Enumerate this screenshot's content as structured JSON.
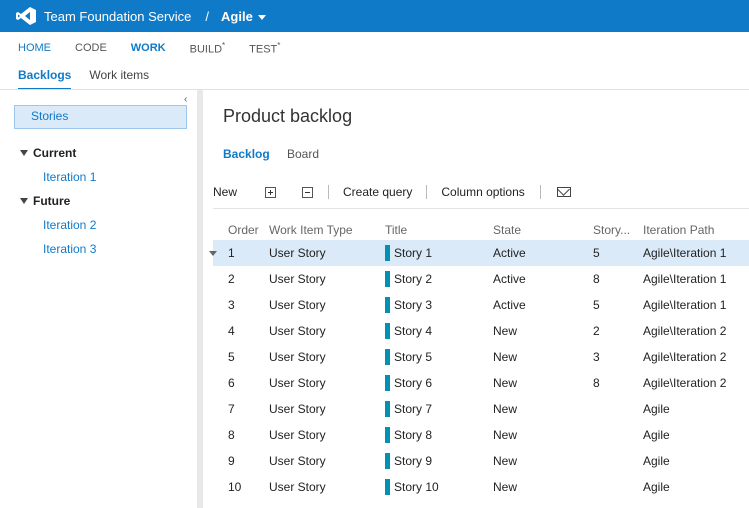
{
  "app": {
    "brand": "Team Foundation Service",
    "separator": "/",
    "project": "Agile"
  },
  "hubs": [
    {
      "label": "HOME",
      "sup": ""
    },
    {
      "label": "CODE",
      "sup": ""
    },
    {
      "label": "WORK",
      "sup": ""
    },
    {
      "label": "BUILD",
      "sup": "*"
    },
    {
      "label": "TEST",
      "sup": "*"
    }
  ],
  "subtabs": [
    "Backlogs",
    "Work items"
  ],
  "left": {
    "selected": "Stories",
    "groups": [
      {
        "label": "Current",
        "items": [
          "Iteration 1"
        ]
      },
      {
        "label": "Future",
        "items": [
          "Iteration 2",
          "Iteration 3"
        ]
      }
    ]
  },
  "main": {
    "title": "Product backlog",
    "tabs": [
      "Backlog",
      "Board"
    ],
    "toolbar": {
      "new": "New",
      "create_query": "Create query",
      "column_options": "Column options"
    }
  },
  "grid": {
    "columns": [
      "Order",
      "Work Item Type",
      "Title",
      "State",
      "Story...",
      "Iteration Path"
    ],
    "rows": [
      {
        "order": "1",
        "type": "User Story",
        "title": "Story 1",
        "state": "Active",
        "points": "5",
        "iteration": "Agile\\Iteration 1"
      },
      {
        "order": "2",
        "type": "User Story",
        "title": "Story 2",
        "state": "Active",
        "points": "8",
        "iteration": "Agile\\Iteration 1"
      },
      {
        "order": "3",
        "type": "User Story",
        "title": "Story 3",
        "state": "Active",
        "points": "5",
        "iteration": "Agile\\Iteration 1"
      },
      {
        "order": "4",
        "type": "User Story",
        "title": "Story 4",
        "state": "New",
        "points": "2",
        "iteration": "Agile\\Iteration 2"
      },
      {
        "order": "5",
        "type": "User Story",
        "title": "Story 5",
        "state": "New",
        "points": "3",
        "iteration": "Agile\\Iteration 2"
      },
      {
        "order": "6",
        "type": "User Story",
        "title": "Story 6",
        "state": "New",
        "points": "8",
        "iteration": "Agile\\Iteration 2"
      },
      {
        "order": "7",
        "type": "User Story",
        "title": "Story 7",
        "state": "New",
        "points": "",
        "iteration": "Agile"
      },
      {
        "order": "8",
        "type": "User Story",
        "title": "Story 8",
        "state": "New",
        "points": "",
        "iteration": "Agile"
      },
      {
        "order": "9",
        "type": "User Story",
        "title": "Story 9",
        "state": "New",
        "points": "",
        "iteration": "Agile"
      },
      {
        "order": "10",
        "type": "User Story",
        "title": "Story 10",
        "state": "New",
        "points": "",
        "iteration": "Agile"
      }
    ]
  },
  "colors": {
    "brand_blue": "#0f7ac8",
    "selection": "#dbeaf8",
    "work_item_bar": "#0091b3"
  }
}
